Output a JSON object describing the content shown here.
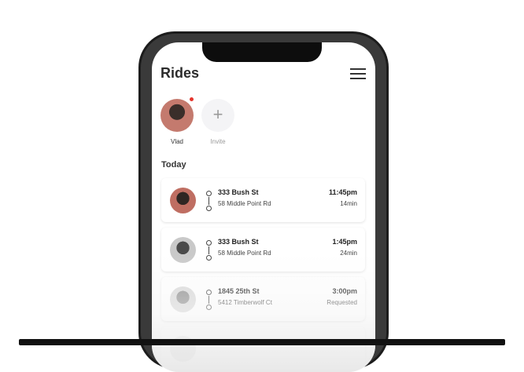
{
  "header": {
    "title": "Rides",
    "menu_icon": "hamburger-menu-icon"
  },
  "stories": [
    {
      "name": "Vlad",
      "online_dot_color": "#e5342c"
    },
    {
      "name": "Invite",
      "icon": "plus-icon",
      "glyph": "+"
    }
  ],
  "section_title": "Today",
  "rides": [
    {
      "from": "333 Bush St",
      "to": "58 Middle Point Rd",
      "time": "11:45pm",
      "meta": "14min"
    },
    {
      "from": "333 Bush St",
      "to": "58 Middle Point Rd",
      "time": "1:45pm",
      "meta": "24min"
    },
    {
      "from": "1845 25th St",
      "to": "5412 Timberwolf Ct",
      "time": "3:00pm",
      "meta": "Requested"
    }
  ],
  "colors": {
    "accent_dot": "#e5342c",
    "text": "#2b2b2b",
    "invite_text": "#9a9a9a"
  }
}
